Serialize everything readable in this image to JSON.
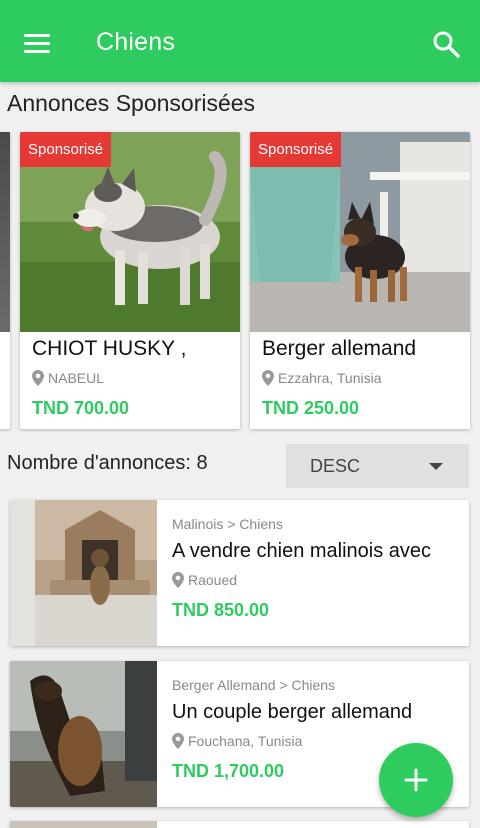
{
  "app": {
    "title": "Chiens",
    "accent_color": "#2ecc5e",
    "menu_icon": "hamburger-menu-icon",
    "search_icon": "search-icon"
  },
  "sponsored": {
    "section_title": "Annonces Sponsorisées",
    "badge_color": "#e53935",
    "items": [
      {
        "badge": "Sponsorisé",
        "title": "CHIOT HUSKY ,",
        "location": "NABEUL",
        "price": "TND 700.00"
      },
      {
        "badge": "Sponsorisé",
        "title": "Berger allemand",
        "location": "Ezzahra, Tunisia",
        "price": "TND 250.00"
      }
    ]
  },
  "listing": {
    "count_label": "Nombre d'annonces: 8",
    "sort_value": "DESC",
    "items": [
      {
        "category": "Malinois > Chiens",
        "title": "A vendre chien malinois avec",
        "location": "Raoued",
        "price": "TND 850.00"
      },
      {
        "category": "Berger Allemand > Chiens",
        "title": "Un couple berger allemand",
        "location": "Fouchana, Tunisia",
        "price": "TND 1,700.00"
      }
    ]
  },
  "fab": {
    "icon": "plus-icon"
  }
}
